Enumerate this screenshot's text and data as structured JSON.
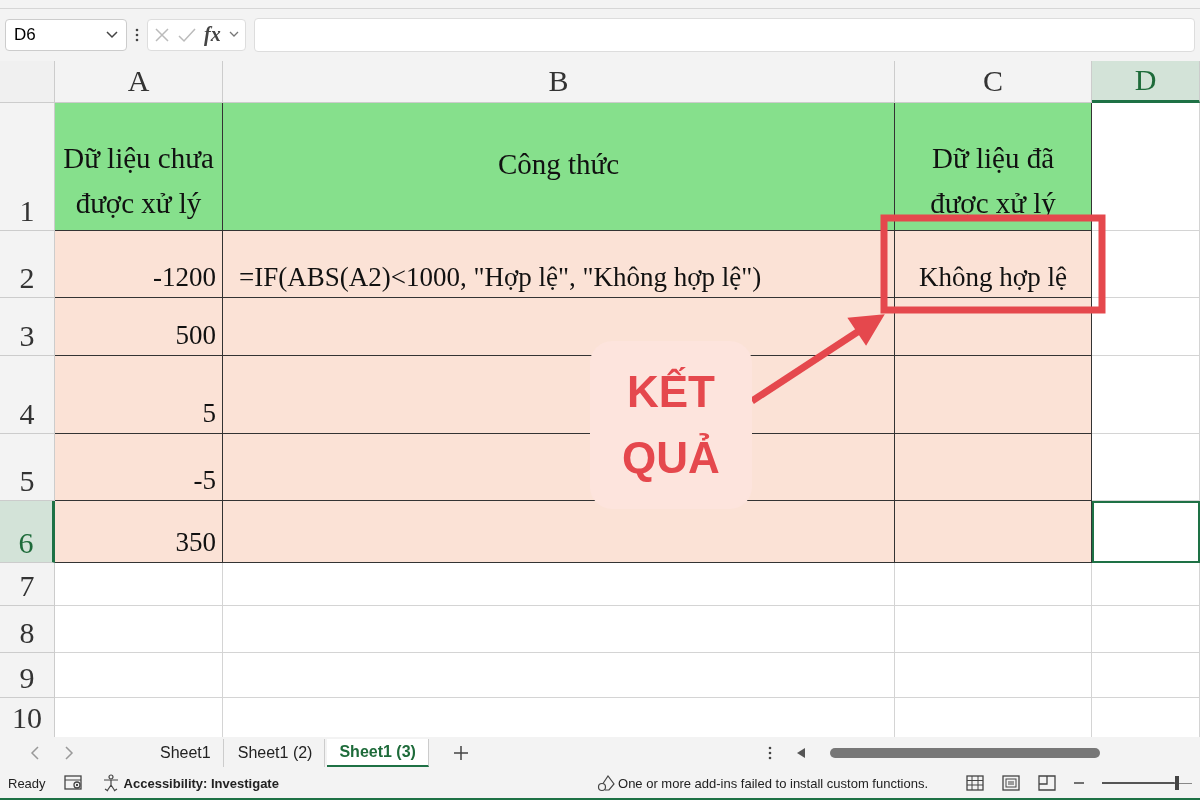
{
  "name_box": {
    "value": "D6"
  },
  "formula_bar": {
    "function_label": "fx"
  },
  "columns": [
    {
      "label": "A",
      "selected": false
    },
    {
      "label": "B",
      "selected": false
    },
    {
      "label": "C",
      "selected": false
    },
    {
      "label": "D",
      "selected": true
    }
  ],
  "rows": [
    {
      "number": "1",
      "kind": "header",
      "selected": false,
      "a": "Dữ liệu chưa được xử lý",
      "b": "Công thức",
      "c": "Dữ liệu đã được xử lý"
    },
    {
      "number": "2",
      "kind": "data",
      "selected": false,
      "a": "-1200",
      "b": "=IF(ABS(A2)<1000, \"Hợp lệ\", \"Không hợp lệ\")",
      "c": "Không hợp lệ"
    },
    {
      "number": "3",
      "kind": "data",
      "selected": false,
      "a": "500"
    },
    {
      "number": "4",
      "kind": "data",
      "selected": false,
      "a": "5"
    },
    {
      "number": "5",
      "kind": "data",
      "selected": false,
      "a": "-5"
    },
    {
      "number": "6",
      "kind": "data",
      "selected": true,
      "a": "350",
      "active": true
    },
    {
      "number": "7",
      "kind": "blank",
      "selected": false
    },
    {
      "number": "8",
      "kind": "blank",
      "selected": false
    },
    {
      "number": "9",
      "kind": "blank",
      "selected": false
    },
    {
      "number": "10",
      "kind": "blank",
      "selected": false
    }
  ],
  "callout": {
    "lines": [
      "KẾT",
      "QUẢ"
    ]
  },
  "sheet_tabs": [
    {
      "label": "Sheet1",
      "selected": false
    },
    {
      "label": "Sheet1 (2)",
      "selected": false
    },
    {
      "label": "Sheet1 (3)",
      "selected": true
    }
  ],
  "status_bar": {
    "mode": "Ready",
    "accessibility": "Accessibility: Investigate",
    "message": "One or more add-ins failed to install custom functions."
  },
  "zoom_slider": {
    "level": 0.85
  }
}
